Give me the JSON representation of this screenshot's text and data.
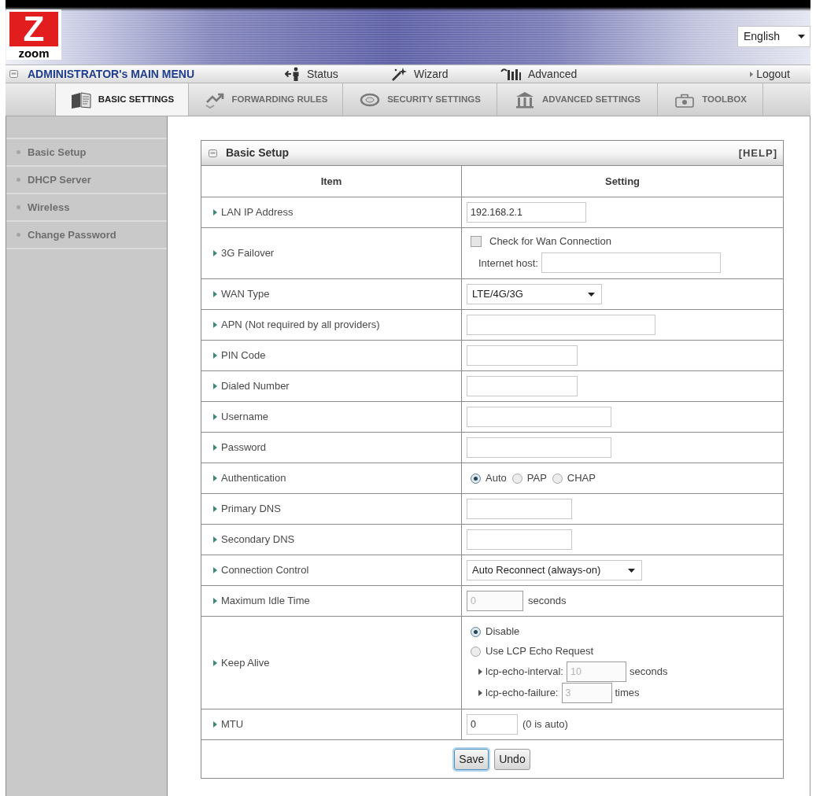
{
  "header": {
    "logo": {
      "mark": "Z",
      "text": "zoom"
    },
    "language_select": {
      "value": "English"
    }
  },
  "main_menu": {
    "title": "ADMINISTRATOR's MAIN MENU",
    "items": [
      {
        "label": "Status"
      },
      {
        "label": "Wizard"
      },
      {
        "label": "Advanced"
      }
    ],
    "logout": "Logout"
  },
  "tabs": [
    {
      "label": "BASIC SETTINGS",
      "selected": true
    },
    {
      "label": "FORWARDING RULES",
      "selected": false
    },
    {
      "label": "SECURITY SETTINGS",
      "selected": false
    },
    {
      "label": "ADVANCED SETTINGS",
      "selected": false
    },
    {
      "label": "TOOLBOX",
      "selected": false
    }
  ],
  "sidebar": {
    "items": [
      {
        "label": "Basic Setup"
      },
      {
        "label": "DHCP Server"
      },
      {
        "label": "Wireless"
      },
      {
        "label": "Change Password"
      }
    ]
  },
  "panel": {
    "title": "Basic Setup",
    "help": "[HELP]",
    "columns": [
      "Item",
      "Setting"
    ],
    "rows": [
      {
        "label": "LAN IP Address",
        "kind": "text",
        "value": "192.168.2.1",
        "disabled": false
      },
      {
        "label": "3G Failover",
        "kind": "failover",
        "checkbox": {
          "label": "Check for Wan Connection",
          "checked": false
        },
        "field_label": "Internet host:"
      },
      {
        "label": "WAN Type",
        "kind": "select",
        "value": "LTE/4G/3G"
      },
      {
        "label": "APN (Not required by all providers)",
        "kind": "text",
        "disabled": false
      },
      {
        "label": "PIN Code",
        "kind": "text",
        "disabled": false
      },
      {
        "label": "Dialed Number",
        "kind": "text",
        "disabled": false
      },
      {
        "label": "Username",
        "kind": "text",
        "disabled": false
      },
      {
        "label": "Password",
        "kind": "text",
        "disabled": false
      },
      {
        "label": "Authentication",
        "kind": "radio",
        "options": [
          {
            "label": "Auto",
            "selected": true
          },
          {
            "label": "PAP",
            "selected": false
          },
          {
            "label": "CHAP",
            "selected": false
          }
        ]
      },
      {
        "label": "Primary DNS",
        "kind": "text",
        "disabled": false
      },
      {
        "label": "Secondary DNS",
        "kind": "text",
        "disabled": false
      },
      {
        "label": "Connection Control",
        "kind": "select",
        "value": "Auto Reconnect (always-on)"
      },
      {
        "label": "Maximum Idle Time",
        "kind": "text",
        "value": "0",
        "disabled": true,
        "suffix": "seconds"
      },
      {
        "label": "Keep Alive",
        "kind": "keepalive",
        "options": [
          {
            "label": "Disable",
            "selected": true
          },
          {
            "label": "Use LCP Echo Request",
            "selected": false
          }
        ],
        "subfields": [
          {
            "label": "lcp-echo-interval:",
            "value": "10",
            "disabled": true,
            "suffix": "seconds"
          },
          {
            "label": "lcp-echo-failure:",
            "value": "3",
            "disabled": true,
            "suffix": "times"
          }
        ]
      },
      {
        "label": "MTU",
        "kind": "text",
        "value": "0",
        "disabled": false,
        "suffix": "(0 is auto)"
      }
    ],
    "buttons": [
      {
        "label": "Save",
        "focused": true
      },
      {
        "label": "Undo",
        "focused": false
      }
    ]
  }
}
